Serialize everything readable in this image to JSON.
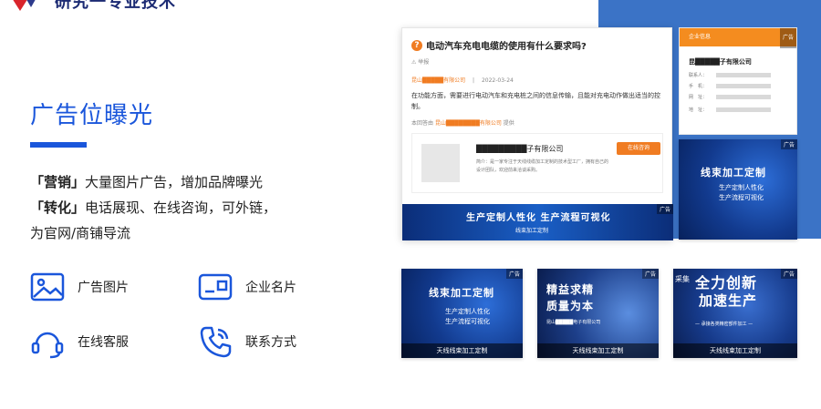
{
  "brand": {
    "text": "研究一专业技术"
  },
  "hero": {
    "title": "广告位曝光",
    "lines": [
      {
        "kw": "「营销」",
        "rest": "大量图片广告，增加品牌曝光"
      },
      {
        "kw": "「转化」",
        "rest": "电话展现、在线咨询，可外链，"
      },
      {
        "kw": "",
        "rest": "为官网/商铺导流"
      }
    ]
  },
  "features": [
    {
      "label": "广告图片",
      "icon": "image-icon"
    },
    {
      "label": "企业名片",
      "icon": "business-card-icon"
    },
    {
      "label": "在线客服",
      "icon": "headset-icon"
    },
    {
      "label": "联系方式",
      "icon": "phone-icon"
    }
  ],
  "question_card": {
    "title": "电动汽车充电电缆的使用有什么要求吗?",
    "meta": "⚠ 举报",
    "company": "昆山█████有限公司",
    "date": "2022-03-24",
    "body": "在功能方面，需要进行电动汽车和充电桩之间的信息传输，且能对充电动作做出适当的控制。",
    "source_prefix": "本回答由",
    "source_company": "昆山████████有限公司",
    "source_suffix": "提供",
    "inner": {
      "company": "█████████子有限公司",
      "intro_prefix": "简介：",
      "intro": "是一家专注于天线线缆加工定制的技术型工厂，拥有自己的设计团队，欢迎前来洽谈采购。",
      "button": "在线咨询"
    },
    "banner": {
      "headline": "生产定制人性化 生产流程可视化",
      "sub": "线束加工定制",
      "ad": "广告"
    }
  },
  "info_card": {
    "header": "企业信息",
    "ad": "广告",
    "company": "昆█████子有限公司",
    "rows": [
      "联系人：",
      "手　机：",
      "网　址：",
      "地　址："
    ]
  },
  "tiles": [
    {
      "headline": "线束加工定制",
      "sub1": "生产定制人性化",
      "sub2": "生产流程可视化",
      "foot": "",
      "ad": "广告"
    },
    {
      "headline": "线束加工定制",
      "sub1": "生产定制人性化",
      "sub2": "生产流程可视化",
      "foot": "天线线束加工定制",
      "ad": "广告"
    },
    {
      "headline": "精益求精",
      "sub1": "质量为本",
      "sub2": "昆山█████电子有限公司",
      "foot": "天线线束加工定制",
      "ad": "广告"
    },
    {
      "headline": "全力创新",
      "sub1": "加速生产",
      "sub2": "— 承接各类精密部件加工 —",
      "foot": "天线线束加工定制",
      "ad": "广告",
      "pre": "采集"
    }
  ]
}
